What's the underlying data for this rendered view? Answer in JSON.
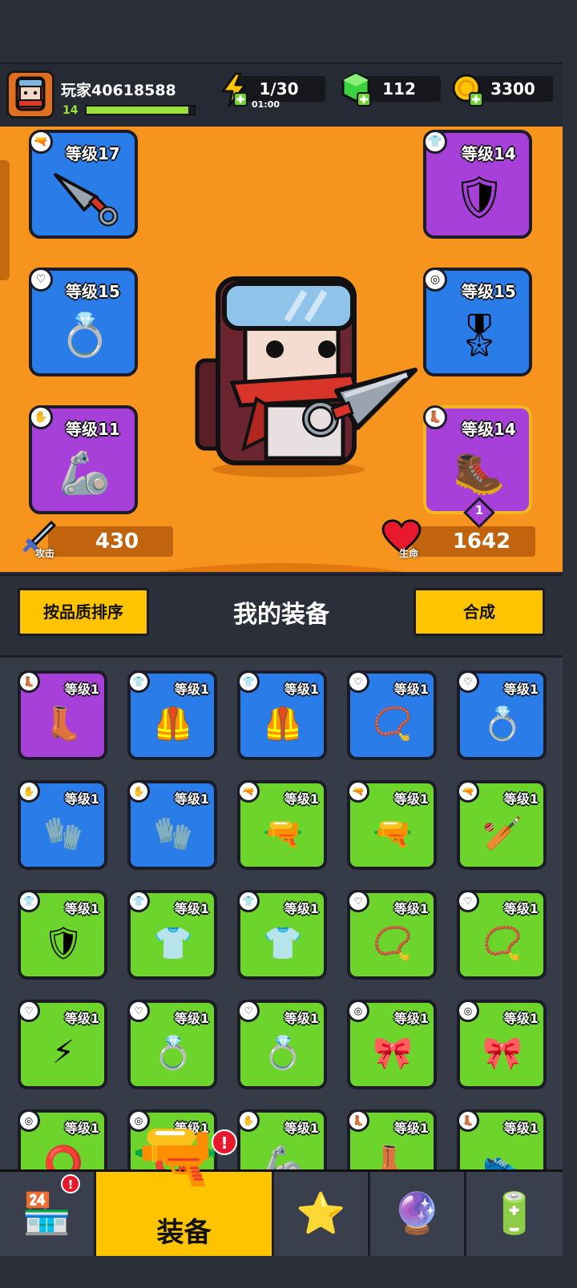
{
  "player": {
    "name": "玩家40618588",
    "level": "14",
    "xp_fraction": 0.95
  },
  "resources": {
    "energy": {
      "value": "1/30",
      "timer": "01:00"
    },
    "gems": {
      "value": "112"
    },
    "coins": {
      "value": "3300"
    }
  },
  "equipped": {
    "weapon": {
      "level": "等级17",
      "slot_icon": "gun-icon",
      "art": "kunai-icon"
    },
    "armor": {
      "level": "等级14",
      "slot_icon": "shirt-icon",
      "art": "armor-icon"
    },
    "necklace": {
      "level": "等级15",
      "slot_icon": "necklace-icon",
      "art": "ring-belt-icon"
    },
    "belt": {
      "level": "等级15",
      "slot_icon": "belt-icon",
      "art": "belt-icon"
    },
    "gloves": {
      "level": "等级11",
      "slot_icon": "glove-icon",
      "art": "gauntlet-icon"
    },
    "boots": {
      "level": "等级14",
      "slot_icon": "boot-icon",
      "art": "boot-icon",
      "badge": "1"
    }
  },
  "stats": {
    "attack_label": "攻击",
    "attack": "430",
    "hp_label": "生命",
    "hp": "1642"
  },
  "equipment_section": {
    "sort_button": "按品质排序",
    "title": "我的装备",
    "merge_button": "合成"
  },
  "inventory": [
    {
      "level": "等级1",
      "rarity": "purple",
      "slot": "boot",
      "art": "👢"
    },
    {
      "level": "等级1",
      "rarity": "blue",
      "slot": "shirt",
      "art": "🦺"
    },
    {
      "level": "等级1",
      "rarity": "blue",
      "slot": "shirt",
      "art": "🦺"
    },
    {
      "level": "等级1",
      "rarity": "blue",
      "slot": "necklace",
      "art": "📿"
    },
    {
      "level": "等级1",
      "rarity": "blue",
      "slot": "necklace",
      "art": "💍"
    },
    {
      "level": "等级1",
      "rarity": "blue",
      "slot": "glove",
      "art": "🧤"
    },
    {
      "level": "等级1",
      "rarity": "blue",
      "slot": "glove",
      "art": "🧤"
    },
    {
      "level": "等级1",
      "rarity": "green",
      "slot": "gun",
      "art": "🔫"
    },
    {
      "level": "等级1",
      "rarity": "green",
      "slot": "gun",
      "art": "🔫"
    },
    {
      "level": "等级1",
      "rarity": "green",
      "slot": "gun",
      "art": "🏏"
    },
    {
      "level": "等级1",
      "rarity": "green",
      "slot": "shirt",
      "art": "🛡"
    },
    {
      "level": "等级1",
      "rarity": "green",
      "slot": "shirt",
      "art": "👕"
    },
    {
      "level": "等级1",
      "rarity": "green",
      "slot": "shirt",
      "art": "👕"
    },
    {
      "level": "等级1",
      "rarity": "green",
      "slot": "necklace",
      "art": "📿"
    },
    {
      "level": "等级1",
      "rarity": "green",
      "slot": "necklace",
      "art": "📿"
    },
    {
      "level": "等级1",
      "rarity": "green",
      "slot": "necklace",
      "art": "⚡"
    },
    {
      "level": "等级1",
      "rarity": "green",
      "slot": "necklace",
      "art": "💍"
    },
    {
      "level": "等级1",
      "rarity": "green",
      "slot": "necklace",
      "art": "💍"
    },
    {
      "level": "等级1",
      "rarity": "green",
      "slot": "belt",
      "art": "🎀"
    },
    {
      "level": "等级1",
      "rarity": "green",
      "slot": "belt",
      "art": "🎀"
    },
    {
      "level": "等级1",
      "rarity": "green",
      "slot": "belt",
      "art": "⭕"
    },
    {
      "level": "等级1",
      "rarity": "green",
      "slot": "belt",
      "art": "⭕"
    },
    {
      "level": "等级1",
      "rarity": "green",
      "slot": "glove",
      "art": "🦾"
    },
    {
      "level": "等级1",
      "rarity": "green",
      "slot": "boot",
      "art": "👢"
    },
    {
      "level": "等级1",
      "rarity": "green",
      "slot": "boot",
      "art": "👟"
    }
  ],
  "nav": {
    "equip_label": "装备",
    "shop_badge": "!",
    "equip_badge": "!"
  },
  "colors": {
    "orange_bg": "#f7941d",
    "blue": "#2a7de8",
    "purple": "#a640d8",
    "green": "#6cd42a",
    "yellow_button": "#ffc400"
  }
}
